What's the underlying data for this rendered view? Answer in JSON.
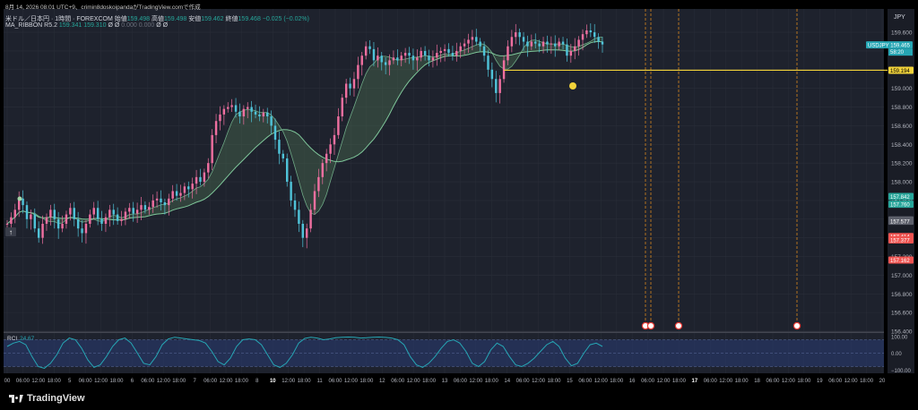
{
  "header": {
    "snapshot_line": "8月 14, 2026 08:01 UTC+9、crimin8doskoipandaがTradingView.comで作成",
    "symbol": "米ドル／日本円 · 1時間 · FOREXCOM",
    "open_label": "始値",
    "open": "159.498",
    "high_label": "高値",
    "high": "159.498",
    "low_label": "安値",
    "low": "159.462",
    "close_label": "終値",
    "close": "159.468",
    "change": "−0.025 (−0.02%)",
    "ma_name": "MA_RIBBON R5.2",
    "ma_v1": "159.341",
    "ma_v2": "159.310",
    "ma_v3": "Ø",
    "ma_v4": "Ø",
    "ma_v5": "0.000",
    "ma_v6": "0.000",
    "ma_v7": "Ø",
    "ma_v8": "Ø"
  },
  "footer": {
    "brand": "TradingView"
  },
  "colors": {
    "bg": "#1e222d",
    "grid": "#2a2e39",
    "up": "#ef6fa0",
    "down": "#4fc3d9",
    "ribbon_fill": "#4a6b4f",
    "ribbon_line": "#7fc79a",
    "yellow": "#f2d33a",
    "event_line": "#d6861f",
    "rci": "#26a6b4",
    "rci_band": "#283a6e"
  },
  "chart_data": {
    "type": "candlestick",
    "title": "",
    "currency": "JPY",
    "price_axis": {
      "ylim": [
        156.4,
        159.85
      ],
      "ticks": [
        "159.600",
        "159.400",
        "159.200",
        "159.000",
        "158.800",
        "158.600",
        "158.400",
        "158.200",
        "158.000",
        "157.800",
        "157.600",
        "157.400",
        "157.200",
        "157.000",
        "156.800",
        "156.600",
        "156.400"
      ],
      "tick_values": [
        159.6,
        159.4,
        159.2,
        159.0,
        158.8,
        158.6,
        158.4,
        158.2,
        158.0,
        157.8,
        157.6,
        157.4,
        157.2,
        157.0,
        156.8,
        156.6,
        156.4
      ]
    },
    "price_labels": [
      {
        "text": "USDJPY  159.465",
        "value": 159.465,
        "sub": "58:20",
        "bg": "#26a6b4"
      },
      {
        "text": "159.194",
        "value": 159.194,
        "bg": "#f2d33a"
      },
      {
        "text": "157.842",
        "value": 157.842,
        "bg": "#26a69a"
      },
      {
        "text": "157.760",
        "value": 157.76,
        "bg": "#26a69a"
      },
      {
        "text": "157.592",
        "value": 157.592,
        "bg": "#5d606b"
      },
      {
        "text": "157.577",
        "value": 157.577,
        "bg": "#5d606b"
      },
      {
        "text": "157.414",
        "value": 157.414,
        "bg": "#ef5350"
      },
      {
        "text": "157.377",
        "value": 157.377,
        "bg": "#ef5350"
      },
      {
        "text": "157.162",
        "value": 157.162,
        "bg": "#ef5350"
      }
    ],
    "horizontal_line": {
      "value": 159.194,
      "start_index": 126
    },
    "time_axis": {
      "labels": [
        "00",
        "06:00",
        "12:00",
        "18:00",
        "5",
        "06:00",
        "12:00",
        "18:00",
        "6",
        "06:00",
        "12:00",
        "18:00",
        "7",
        "06:00",
        "12:00",
        "18:00",
        "8",
        "10",
        "12:00",
        "18:00",
        "11",
        "06:00",
        "12:00",
        "18:00",
        "12",
        "06:00",
        "12:00",
        "18:00",
        "13",
        "06:00",
        "12:00",
        "18:00",
        "14",
        "06:00",
        "12:00",
        "18:00",
        "15",
        "06:00",
        "12:00",
        "18:00",
        "16",
        "06:00",
        "12:00",
        "18:00",
        "17",
        "06:00",
        "12:00",
        "18:00",
        "18",
        "06:00",
        "12:00",
        "18:00",
        "19",
        "06:00",
        "12:00",
        "18:00",
        "20"
      ],
      "bold": [
        "10",
        "17"
      ]
    },
    "series": [
      {
        "name": "USDJPY",
        "values": [
          157.55,
          157.62,
          157.7,
          157.82,
          157.75,
          157.6,
          157.65,
          157.5,
          157.4,
          157.55,
          157.62,
          157.7,
          157.6,
          157.5,
          157.55,
          157.65,
          157.72,
          157.6,
          157.5,
          157.45,
          157.55,
          157.65,
          157.72,
          157.6,
          157.55,
          157.62,
          157.7,
          157.65,
          157.58,
          157.6,
          157.68,
          157.72,
          157.66,
          157.7,
          157.75,
          157.7,
          157.73,
          157.8,
          157.82,
          157.78,
          157.75,
          157.82,
          157.9,
          157.85,
          157.88,
          157.95,
          157.92,
          157.98,
          158.05,
          158.0,
          158.1,
          158.2,
          158.5,
          158.65,
          158.72,
          158.78,
          158.8,
          158.82,
          158.75,
          158.7,
          158.78,
          158.8,
          158.75,
          158.72,
          158.7,
          158.74,
          158.7,
          158.6,
          158.45,
          158.3,
          158.25,
          158.0,
          157.8,
          157.7,
          157.55,
          157.4,
          157.5,
          157.7,
          157.9,
          158.05,
          158.2,
          158.3,
          158.4,
          158.5,
          158.7,
          158.9,
          159.05,
          159.0,
          159.1,
          159.25,
          159.35,
          159.45,
          159.42,
          159.3,
          159.35,
          159.28,
          159.25,
          159.3,
          159.33,
          159.3,
          159.35,
          159.38,
          159.35,
          159.3,
          159.33,
          159.4,
          159.35,
          159.3,
          159.33,
          159.38,
          159.4,
          159.42,
          159.38,
          159.35,
          159.4,
          159.45,
          159.48,
          159.52,
          159.55,
          159.5,
          159.45,
          159.35,
          159.2,
          159.1,
          158.95,
          159.1,
          159.3,
          159.45,
          159.55,
          159.6,
          159.55,
          159.5,
          159.45,
          159.5,
          159.48,
          159.45,
          159.5,
          159.47,
          159.48,
          159.45,
          159.5,
          159.47,
          159.35,
          159.4,
          159.45,
          159.52,
          159.58,
          159.62,
          159.6,
          159.55,
          159.5,
          159.47
        ]
      },
      {
        "name": "MA_RIBBON R5.2",
        "values": [
          159.341,
          159.31
        ]
      },
      {
        "name": "RCI",
        "values": [
          24.67
        ]
      }
    ],
    "rci": {
      "label": "RCI",
      "value": "24.67",
      "ticks": [
        "100.00",
        "0.00",
        "−100.00"
      ],
      "tick_values": [
        100,
        0,
        -100
      ],
      "ylim": [
        -120,
        120
      ],
      "values": [
        40,
        60,
        70,
        50,
        -20,
        -80,
        -90,
        -60,
        -10,
        60,
        90,
        80,
        30,
        -40,
        -85,
        -70,
        -20,
        40,
        80,
        90,
        60,
        0,
        -60,
        -70,
        -20,
        50,
        85,
        95,
        90,
        85,
        80,
        75,
        60,
        10,
        -50,
        -70,
        -30,
        40,
        80,
        85,
        80,
        50,
        -10,
        -70,
        -85,
        -60,
        -10,
        60,
        88,
        95,
        90,
        80,
        85,
        92,
        95,
        96,
        95,
        90,
        92,
        95,
        96,
        94,
        90,
        80,
        50,
        -20,
        -70,
        -85,
        -60,
        -20,
        30,
        70,
        80,
        60,
        10,
        -60,
        -80,
        -50,
        20,
        60,
        40,
        -20,
        -70,
        -80,
        -60,
        -30,
        10,
        50,
        70,
        40,
        -30,
        -75,
        -60,
        0,
        50,
        60,
        40
      ]
    }
  }
}
